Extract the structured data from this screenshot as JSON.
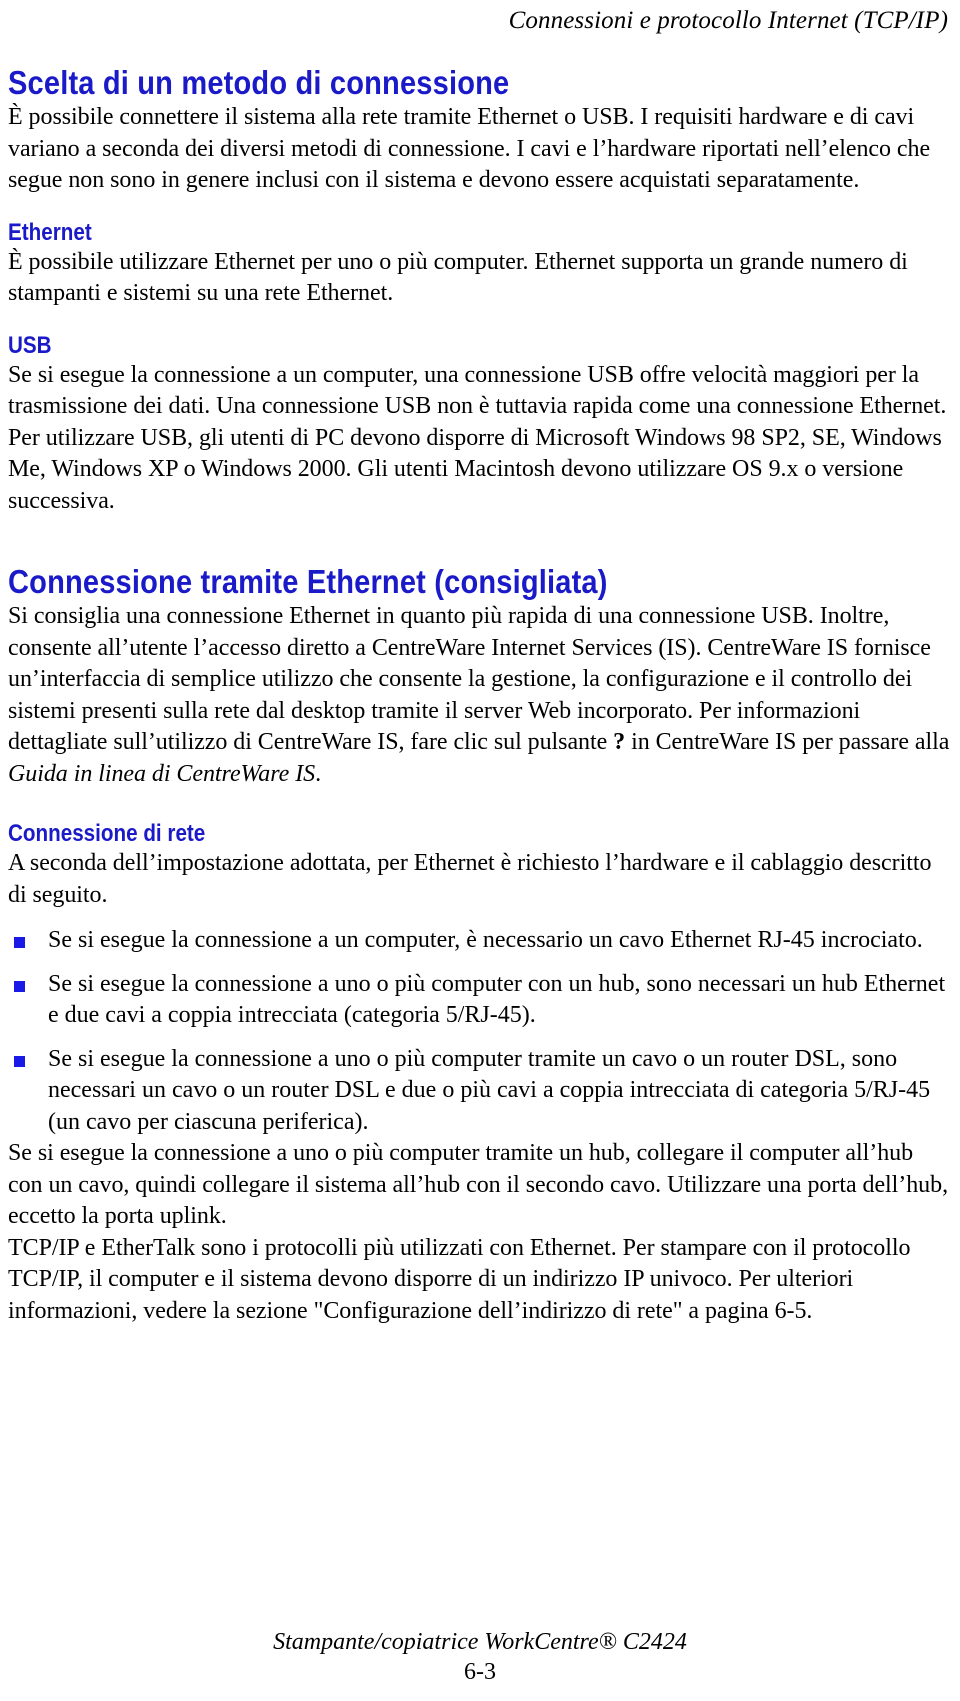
{
  "header": {
    "running_title": "Connessioni e protocollo Internet (TCP/IP)"
  },
  "sections": {
    "choose_method": {
      "heading": "Scelta di un metodo di connessione",
      "intro": "È possibile connettere il sistema alla rete tramite Ethernet o USB. I requisiti hardware e di cavi variano a seconda dei diversi metodi di connessione. I cavi e l’hardware riportati nell’elenco che segue non sono in genere inclusi con il sistema e devono essere acquistati separatamente.",
      "ethernet": {
        "heading": "Ethernet",
        "body": "È possibile utilizzare Ethernet per uno o più computer. Ethernet supporta un grande numero di stampanti e sistemi su una rete Ethernet."
      },
      "usb": {
        "heading": "USB",
        "body": "Se si esegue la connessione a un computer, una connessione USB offre velocità maggiori per la trasmissione dei dati. Una connessione USB non è tuttavia rapida come una connessione Ethernet. Per utilizzare USB, gli utenti di PC devono disporre di Microsoft Windows 98 SP2, SE, Windows Me, Windows XP o Windows 2000. Gli utenti Macintosh devono utilizzare OS 9.x o versione successiva."
      }
    },
    "ethernet_connection": {
      "heading": "Connessione tramite Ethernet (consigliata)",
      "paragraph_part1": "Si consiglia una connessione Ethernet in quanto più rapida di una connessione USB. Inoltre, consente all’utente l’accesso diretto a CentreWare Internet Services (IS). CentreWare IS fornisce un’interfaccia di semplice utilizzo che consente la gestione, la configurazione e il controllo dei sistemi presenti sulla rete dal desktop tramite il server Web incorporato. Per informazioni dettagliate sull’utilizzo di CentreWare IS, fare clic sul pulsante ",
      "help_button_glyph": "?",
      "paragraph_part2": " in CentreWare IS per passare alla ",
      "guide_italic": "Guida in linea di CentreWare IS",
      "paragraph_part3": "."
    },
    "network_connection": {
      "heading": "Connessione di rete",
      "intro": "A seconda dell’impostazione adottata, per Ethernet è richiesto l’hardware e il cablaggio descritto di seguito.",
      "bullets": [
        "Se si esegue la connessione a un computer, è necessario un cavo Ethernet RJ-45 incrociato.",
        "Se si esegue la connessione a uno o più computer con un hub, sono necessari un hub Ethernet e due cavi a coppia intrecciata (categoria 5/RJ-45).",
        "Se si esegue la connessione a uno o più computer tramite un cavo o un router DSL, sono necessari un cavo o un router DSL e due o più cavi a coppia intrecciata di categoria 5/RJ-45 (un cavo per ciascuna periferica)."
      ],
      "after_bullets": "Se si esegue la connessione a uno o più computer tramite un hub, collegare il computer all’hub con un cavo, quindi collegare il sistema all’hub con il secondo cavo. Utilizzare una porta dell’hub, eccetto la porta uplink.",
      "tcpip_note": "TCP/IP e EtherTalk sono i protocolli più utilizzati con Ethernet. Per stampare con il protocollo TCP/IP, il computer e il sistema devono disporre di un indirizzo IP univoco. Per ulteriori informazioni, vedere la sezione  \"Configurazione dell’indirizzo di rete\" a pagina 6-5."
    }
  },
  "footer": {
    "product_title": "Stampante/copiatrice WorkCentre® C2424",
    "page_number": "6-3"
  },
  "colors": {
    "heading_blue": "#1a1ac8",
    "bullet_blue": "#1a1ae6",
    "text_black": "#000000",
    "page_background": "#ffffff"
  }
}
